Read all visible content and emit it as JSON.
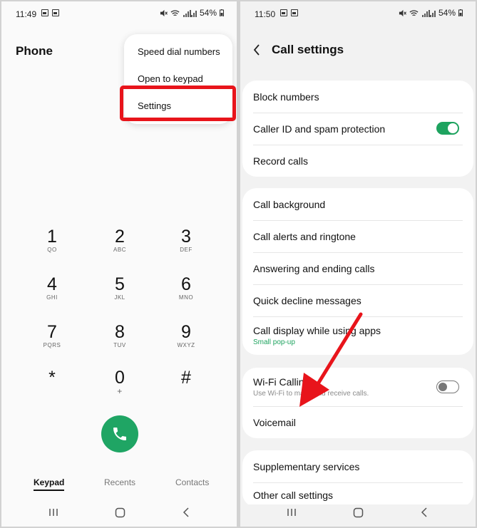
{
  "left": {
    "status": {
      "time": "11:49",
      "battery": "54%"
    },
    "title": "Phone",
    "menu": [
      "Speed dial numbers",
      "Open to keypad",
      "Settings"
    ],
    "keys": [
      {
        "digit": "1",
        "letters": "QO"
      },
      {
        "digit": "2",
        "letters": "ABC"
      },
      {
        "digit": "3",
        "letters": "DEF"
      },
      {
        "digit": "4",
        "letters": "GHI"
      },
      {
        "digit": "5",
        "letters": "JKL"
      },
      {
        "digit": "6",
        "letters": "MNO"
      },
      {
        "digit": "7",
        "letters": "PQRS"
      },
      {
        "digit": "8",
        "letters": "TUV"
      },
      {
        "digit": "9",
        "letters": "WXYZ"
      },
      {
        "digit": "*",
        "letters": ""
      },
      {
        "digit": "0",
        "letters": "+"
      },
      {
        "digit": "#",
        "letters": ""
      }
    ],
    "tabs": [
      "Keypad",
      "Recents",
      "Contacts"
    ]
  },
  "right": {
    "status": {
      "time": "11:50",
      "battery": "54%"
    },
    "title": "Call settings",
    "group1": [
      {
        "label": "Block numbers"
      },
      {
        "label": "Caller ID and spam protection",
        "toggle": true
      },
      {
        "label": "Record calls"
      }
    ],
    "group2": [
      {
        "label": "Call background"
      },
      {
        "label": "Call alerts and ringtone"
      },
      {
        "label": "Answering and ending calls"
      },
      {
        "label": "Quick decline messages"
      },
      {
        "label": "Call display while using apps",
        "sub": "Small pop-up"
      }
    ],
    "group3": [
      {
        "label": "Wi-Fi Calling",
        "sub": "Use Wi-Fi to make and receive calls.",
        "toggle": false
      },
      {
        "label": "Voicemail"
      }
    ],
    "group4": [
      {
        "label": "Supplementary services"
      },
      {
        "label": "Other call settings"
      }
    ]
  },
  "colors": {
    "accent_green": "#1ea35f",
    "highlight_red": "#e8141b"
  },
  "icons": [
    "gallery-icon",
    "sim-icon",
    "mute-icon",
    "wifi-icon",
    "signal-icon",
    "battery-icon",
    "phone-icon",
    "back-arrow-icon",
    "recents-nav-icon",
    "home-nav-icon",
    "back-nav-icon"
  ]
}
